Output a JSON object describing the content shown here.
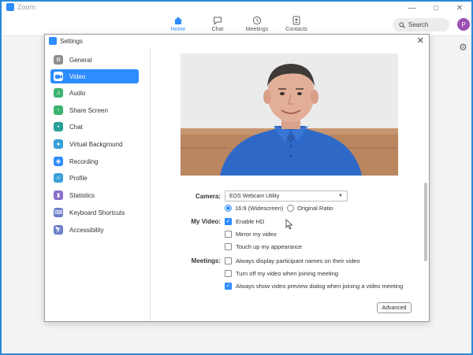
{
  "app": {
    "title": "Zoom",
    "nav": [
      {
        "label": "Home"
      },
      {
        "label": "Chat"
      },
      {
        "label": "Meetings"
      },
      {
        "label": "Contacts"
      }
    ],
    "search_label": "Search",
    "avatar_initial": "P",
    "accent_color": "#2d8cff"
  },
  "settings": {
    "title": "Settings",
    "sidebar": [
      {
        "label": "General",
        "icon": "gear-icon",
        "color": "#8e8e8e"
      },
      {
        "label": "Video",
        "icon": "video-camera-icon",
        "color": "#2d8cff",
        "active": true
      },
      {
        "label": "Audio",
        "icon": "headphones-icon",
        "color": "#3cb371"
      },
      {
        "label": "Share Screen",
        "icon": "share-screen-icon",
        "color": "#3cb371"
      },
      {
        "label": "Chat",
        "icon": "chat-bubble-icon",
        "color": "#2aa198"
      },
      {
        "label": "Virtual Background",
        "icon": "person-icon",
        "color": "#3aa0d8"
      },
      {
        "label": "Recording",
        "icon": "record-icon",
        "color": "#2d8cff"
      },
      {
        "label": "Profile",
        "icon": "profile-icon",
        "color": "#3aa0d8"
      },
      {
        "label": "Statistics",
        "icon": "statistics-icon",
        "color": "#8b6fc9"
      },
      {
        "label": "Keyboard Shortcuts",
        "icon": "keyboard-icon",
        "color": "#6b7cc8"
      },
      {
        "label": "Accessibility",
        "icon": "accessibility-icon",
        "color": "#6b7cc8"
      }
    ],
    "video": {
      "camera_label": "Camera:",
      "camera_value": "EOS Webcam Utility",
      "ratio_options": [
        {
          "label": "16:9 (Widescreen)",
          "selected": true
        },
        {
          "label": "Original Ratio",
          "selected": false
        }
      ],
      "my_video_label": "My Video:",
      "my_video_options": [
        {
          "label": "Enable HD",
          "checked": true
        },
        {
          "label": "Mirror my video",
          "checked": false
        },
        {
          "label": "Touch up my appearance",
          "checked": false
        }
      ],
      "meetings_label": "Meetings:",
      "meetings_options": [
        {
          "label": "Always display participant names on their video",
          "checked": false
        },
        {
          "label": "Turn off my video when joining meeting",
          "checked": false
        },
        {
          "label": "Always show video preview dialog when joining a video meeting",
          "checked": true
        }
      ],
      "advanced_label": "Advanced"
    }
  }
}
